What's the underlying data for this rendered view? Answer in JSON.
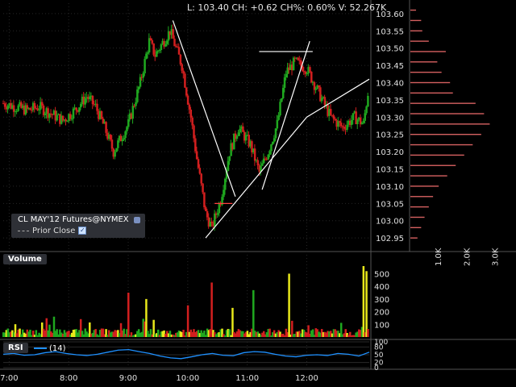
{
  "header": {
    "readout": "L: 103.40  CH: +0.62  CH%: 0.60%  V: 52.267K"
  },
  "legend": {
    "symbol": "CL MAY'12 Futures@NYMEX",
    "prior_close_label": "Prior Close",
    "prior_close_checked": true
  },
  "panes": {
    "volume_label": "Volume",
    "rsi_label": "RSI",
    "rsi_param": "(14)"
  },
  "colors": {
    "up": "#1fa81f",
    "down": "#d21f1f",
    "flat": "#e8e81a",
    "rsi": "#1e90ff",
    "profile": "#d46060",
    "trendline": "#ffffff",
    "prior_close": "#ff4040"
  },
  "chart_data": [
    {
      "type": "candlestick",
      "x_ticks": [
        "7:00",
        "8:00",
        "9:00",
        "10:00",
        "11:00",
        "12:00"
      ],
      "y_ticks": [
        "103.60",
        "103.55",
        "103.50",
        "103.45",
        "103.40",
        "103.35",
        "103.30",
        "103.25",
        "103.20",
        "103.15",
        "103.10",
        "103.05",
        "103.00",
        "102.95"
      ],
      "ylim": [
        102.92,
        103.63
      ],
      "time_range_hours": [
        6.9,
        13.05
      ],
      "price_path": [
        [
          6.9,
          103.34
        ],
        [
          7.1,
          103.33
        ],
        [
          7.3,
          103.32
        ],
        [
          7.5,
          103.33
        ],
        [
          7.7,
          103.31
        ],
        [
          7.9,
          103.29
        ],
        [
          8.1,
          103.32
        ],
        [
          8.3,
          103.36
        ],
        [
          8.45,
          103.33
        ],
        [
          8.6,
          103.27
        ],
        [
          8.75,
          103.2
        ],
        [
          9.0,
          103.28
        ],
        [
          9.2,
          103.4
        ],
        [
          9.35,
          103.52
        ],
        [
          9.45,
          103.48
        ],
        [
          9.7,
          103.55
        ],
        [
          9.9,
          103.45
        ],
        [
          10.05,
          103.3
        ],
        [
          10.15,
          103.18
        ],
        [
          10.3,
          103.02
        ],
        [
          10.4,
          102.98
        ],
        [
          10.55,
          103.06
        ],
        [
          10.7,
          103.2
        ],
        [
          10.85,
          103.27
        ],
        [
          11.05,
          103.22
        ],
        [
          11.2,
          103.14
        ],
        [
          11.35,
          103.2
        ],
        [
          11.5,
          103.28
        ],
        [
          11.65,
          103.43
        ],
        [
          11.8,
          103.46
        ],
        [
          12.0,
          103.44
        ],
        [
          12.2,
          103.37
        ],
        [
          12.4,
          103.3
        ],
        [
          12.6,
          103.27
        ],
        [
          12.8,
          103.3
        ],
        [
          12.95,
          103.28
        ],
        [
          13.05,
          103.4
        ]
      ],
      "trendlines": [
        [
          [
            9.75,
            103.58
          ],
          [
            10.8,
            103.07
          ]
        ],
        [
          [
            10.3,
            102.95
          ],
          [
            12.0,
            103.3
          ]
        ],
        [
          [
            11.25,
            103.09
          ],
          [
            12.05,
            103.52
          ]
        ],
        [
          [
            11.2,
            103.49
          ],
          [
            12.1,
            103.49
          ]
        ],
        [
          [
            10.45,
            103.05
          ],
          [
            10.75,
            103.05
          ]
        ],
        [
          [
            12.0,
            103.3
          ],
          [
            13.05,
            103.41
          ]
        ]
      ],
      "last_price": 103.4,
      "change": 0.62,
      "change_pct": 0.6,
      "volume": "52.267K"
    },
    {
      "type": "horizontal-bar",
      "name": "volume profile",
      "x_ticks": [
        "1.0K",
        "2.0K",
        "3.0K"
      ],
      "xlim": [
        0,
        3500
      ],
      "price_levels": [
        [
          103.61,
          200
        ],
        [
          103.58,
          380
        ],
        [
          103.55,
          420
        ],
        [
          103.52,
          650
        ],
        [
          103.49,
          1250
        ],
        [
          103.46,
          950
        ],
        [
          103.43,
          1100
        ],
        [
          103.4,
          1400
        ],
        [
          103.37,
          1500
        ],
        [
          103.34,
          2300
        ],
        [
          103.31,
          2600
        ],
        [
          103.28,
          2800
        ],
        [
          103.25,
          2500
        ],
        [
          103.22,
          2200
        ],
        [
          103.19,
          1900
        ],
        [
          103.16,
          1600
        ],
        [
          103.13,
          1300
        ],
        [
          103.1,
          1000
        ],
        [
          103.07,
          800
        ],
        [
          103.04,
          650
        ],
        [
          103.01,
          500
        ],
        [
          102.98,
          380
        ],
        [
          102.95,
          250
        ]
      ]
    },
    {
      "type": "bar",
      "name": "Volume",
      "y_ticks": [
        "500",
        "400",
        "300",
        "200",
        "100"
      ],
      "ylim": [
        0,
        560
      ],
      "spikes": [
        [
          9.0,
          350
        ],
        [
          9.3,
          300
        ],
        [
          10.0,
          250
        ],
        [
          10.4,
          430
        ],
        [
          10.75,
          230
        ],
        [
          11.1,
          370
        ],
        [
          11.7,
          500
        ],
        [
          12.95,
          560
        ],
        [
          13.0,
          520
        ]
      ],
      "baseline": 40
    },
    {
      "type": "line",
      "name": "RSI (14)",
      "y_ticks": [
        "100",
        "80",
        "50",
        "20",
        "0"
      ],
      "ylim": [
        0,
        100
      ],
      "values": [
        52,
        55,
        48,
        50,
        58,
        62,
        55,
        50,
        47,
        52,
        60,
        68,
        70,
        62,
        55,
        45,
        38,
        35,
        42,
        50,
        55,
        48,
        46,
        58,
        62,
        60,
        52,
        45,
        42,
        48,
        50,
        47,
        55,
        52,
        45,
        60
      ]
    }
  ]
}
